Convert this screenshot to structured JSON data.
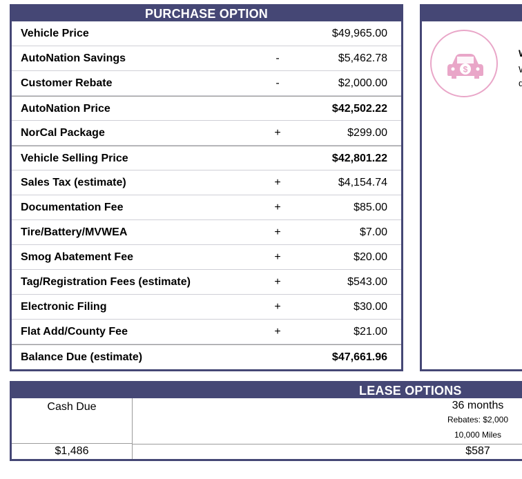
{
  "purchase": {
    "title": "PURCHASE OPTION",
    "rows": [
      {
        "label": "Vehicle Price",
        "sign": "",
        "value": "$49,965.00",
        "bold": false,
        "rule": false
      },
      {
        "label": "AutoNation Savings",
        "sign": "-",
        "value": "$5,462.78",
        "bold": false,
        "rule": false
      },
      {
        "label": "Customer Rebate",
        "sign": "-",
        "value": "$2,000.00",
        "bold": false,
        "rule": false
      },
      {
        "label": "AutoNation Price",
        "sign": "",
        "value": "$42,502.22",
        "bold": true,
        "rule": true
      },
      {
        "label": "NorCal Package",
        "sign": "+",
        "value": "$299.00",
        "bold": false,
        "rule": false
      },
      {
        "label": "Vehicle Selling Price",
        "sign": "",
        "value": "$42,801.22",
        "bold": true,
        "rule": true
      },
      {
        "label": "Sales Tax (estimate)",
        "sign": "+",
        "value": "$4,154.74",
        "bold": false,
        "rule": false
      },
      {
        "label": "Documentation Fee",
        "sign": "+",
        "value": "$85.00",
        "bold": false,
        "rule": false
      },
      {
        "label": "Tire/Battery/MVWEA",
        "sign": "+",
        "value": "$7.00",
        "bold": false,
        "rule": false
      },
      {
        "label": "Smog Abatement Fee",
        "sign": "+",
        "value": "$20.00",
        "bold": false,
        "rule": false
      },
      {
        "label": "Tag/Registration Fees (estimate)",
        "sign": "+",
        "value": "$543.00",
        "bold": false,
        "rule": false
      },
      {
        "label": "Electronic Filing",
        "sign": "+",
        "value": "$30.00",
        "bold": false,
        "rule": false
      },
      {
        "label": "Flat Add/County Fee",
        "sign": "+",
        "value": "$21.00",
        "bold": false,
        "rule": false
      },
      {
        "label": "Balance Due (estimate)",
        "sign": "",
        "value": "$47,661.96",
        "bold": true,
        "rule": true
      }
    ]
  },
  "right_panel": {
    "icon": "car-dollar-icon",
    "title_fragment": "W",
    "text_line1": "W",
    "text_line2": "d"
  },
  "lease": {
    "title": "LEASE OPTIONS",
    "cash_due_label": "Cash Due",
    "cash_due_value": "$1,486",
    "term": "36 months",
    "rebates": "Rebates: $2,000",
    "miles": "10,000 Miles",
    "payment": "$587"
  },
  "colors": {
    "header": "#454775",
    "icon_pink": "#e9a6c8"
  }
}
